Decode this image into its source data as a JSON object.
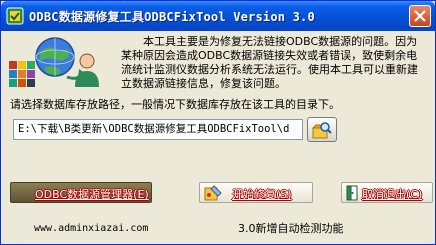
{
  "window": {
    "title": "ODBC数据源修复工具ODBCFixTool Version 3.0",
    "close_icon": "close-icon"
  },
  "intro": {
    "text": "本工具主要是为修复无法链接ODBC数据源的问题。因为某种原因会造成ODBC数据源链接失效或者错误，致使剩余电流统计监测仪数据分析系统无法运行。使用本工具可以重新建立数据源链接信息，修复该问题。"
  },
  "path": {
    "label": "请选择数据库存放路径，一般情况下数据库存放在该工具的目录下。",
    "value": "E:\\下载\\B类更新\\ODBC数据源修复工具ODBCFixTool\\d",
    "browse_icon": "folder-browse-icon"
  },
  "buttons": {
    "manager": "ODBC数据源管理器(E)",
    "start": "开始修复(S)",
    "cancel": "取消退出(C)"
  },
  "footer": {
    "website": "www.adminxiazai.com",
    "version_note": "3.0新增自动检测功能"
  },
  "colors": {
    "titlebar": "#0651d8",
    "window_bg": "#ece9d8",
    "button_text": "#ffffff",
    "button_text_outline": "#b00000"
  }
}
